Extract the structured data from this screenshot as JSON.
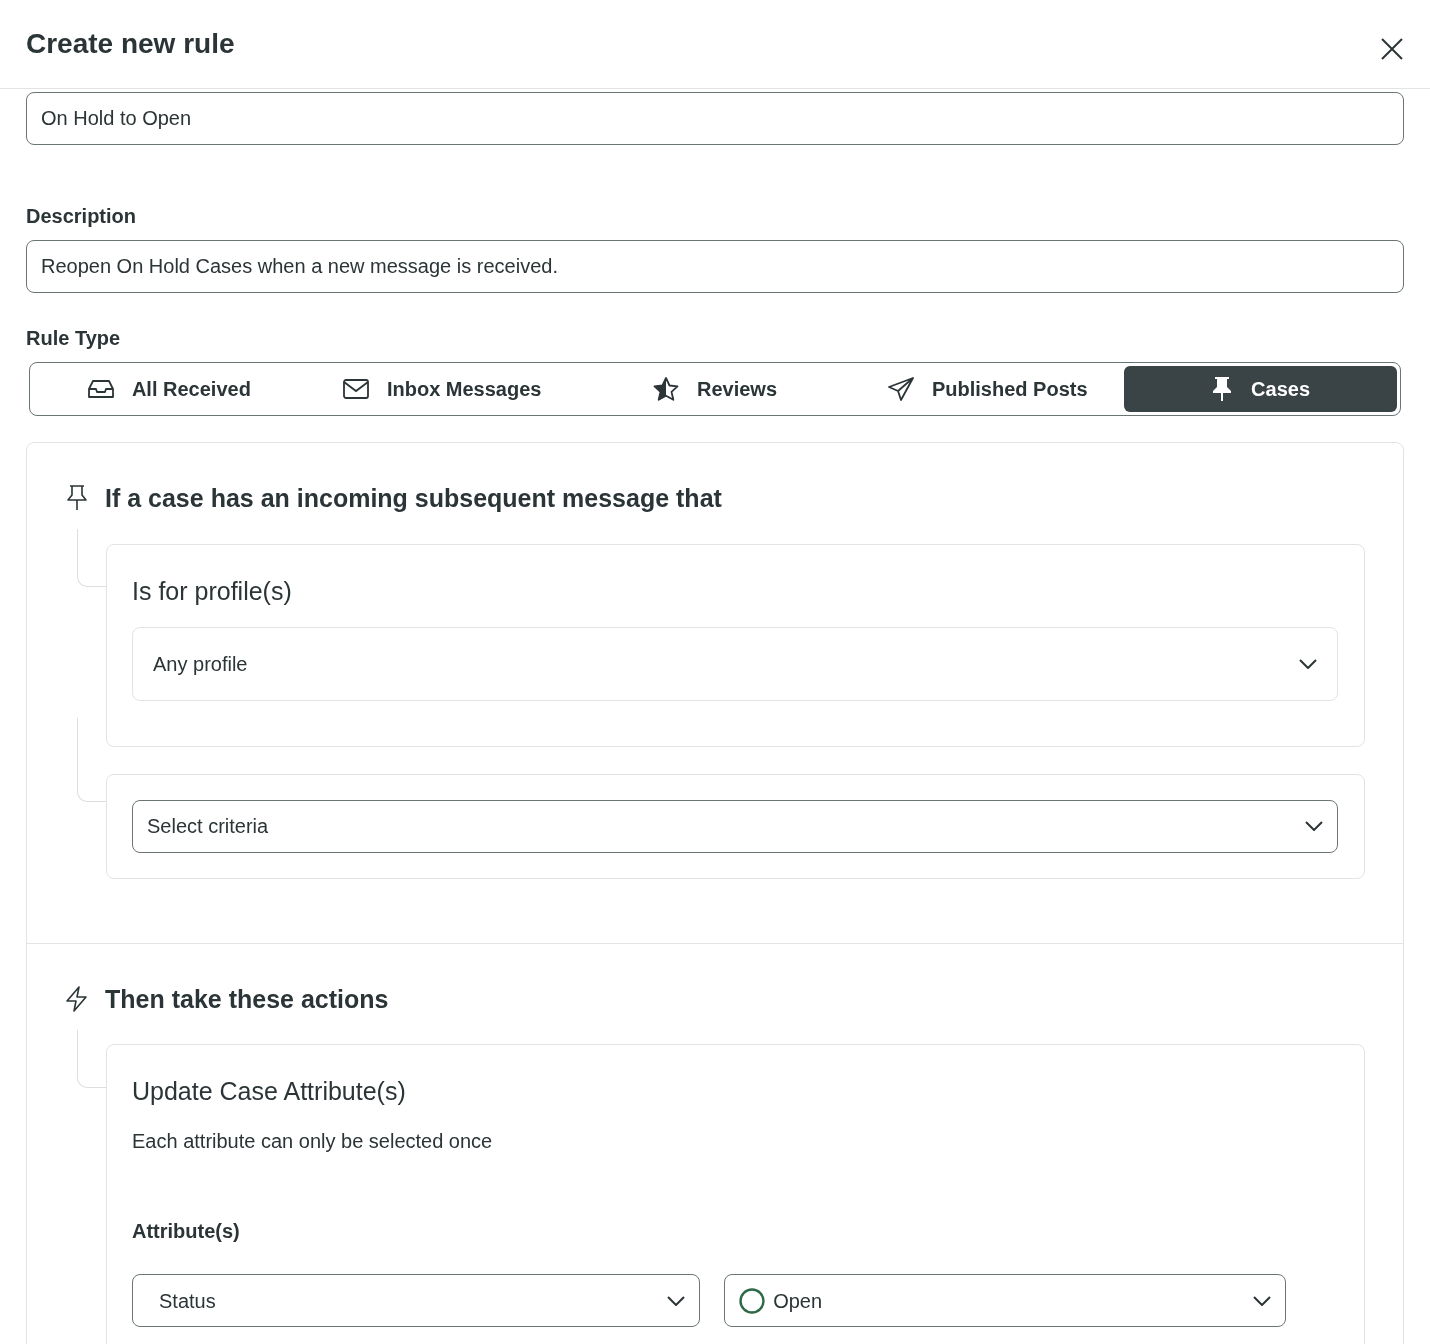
{
  "window": {
    "title": "Create new rule"
  },
  "name_field": {
    "value": "On Hold to Open"
  },
  "description": {
    "label": "Description",
    "value": "Reopen On Hold Cases when a new message is received."
  },
  "rule_type": {
    "label": "Rule Type",
    "tabs": [
      {
        "label": "All Received",
        "selected": false
      },
      {
        "label": "Inbox Messages",
        "selected": false
      },
      {
        "label": "Reviews",
        "selected": false
      },
      {
        "label": "Published Posts",
        "selected": false
      },
      {
        "label": "Cases",
        "selected": true
      }
    ]
  },
  "condition": {
    "heading": "If a case has an incoming subsequent message that",
    "profile_card": {
      "title": "Is for profile(s)",
      "select": "Any profile"
    },
    "criteria_select": {
      "placeholder": "Select criteria"
    }
  },
  "actions": {
    "heading": "Then take these actions",
    "card": {
      "title": "Update Case Attribute(s)",
      "note": "Each attribute can only be selected once",
      "attributes_label": "Attribute(s)",
      "attribute_select": "Status",
      "value_select": "Open"
    }
  }
}
